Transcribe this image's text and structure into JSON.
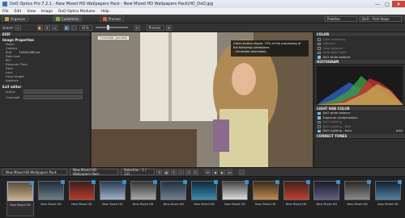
{
  "window": {
    "title": "DxO Optics Pro 7.2.1 - New Mixed HD Wallpapers Pack - New Mixed HD Wallpapers Pack\\HD_DxO.jpg",
    "minimize": "—",
    "maximize": "▢",
    "close": "✕"
  },
  "menu": [
    "File",
    "Edit",
    "View",
    "Image",
    "DxO Optics Modules",
    "Help"
  ],
  "toolbar": {
    "organize": "Organize",
    "customize": "Customize",
    "process": "Process",
    "palettes": "Palettes",
    "workspace": "DxO - First Steps"
  },
  "toolbar2": {
    "search": "Search",
    "zoom": "41%",
    "presets": "Presets"
  },
  "left_panel": {
    "title": "EXIF",
    "section": "Image Properties",
    "rows": [
      {
        "label": "Maker",
        "value": ""
      },
      {
        "label": "Camera",
        "value": ""
      },
      {
        "label": "Size",
        "value": "1920x1080 px"
      },
      {
        "label": "Date shot",
        "value": ""
      },
      {
        "label": "ISO",
        "value": ""
      },
      {
        "label": "Exposure Time",
        "value": ""
      },
      {
        "label": "Flash",
        "value": ""
      },
      {
        "label": "Lens",
        "value": ""
      },
      {
        "label": "Focal Length",
        "value": ""
      },
      {
        "label": "Aperture",
        "value": ""
      }
    ],
    "exif_editor": "Exif editor",
    "author_label": "Author",
    "copyright_label": "Copyright"
  },
  "viewer": {
    "tooltip": "Correction preview",
    "info_lines": [
      "Green button shows: 73% of the processing of",
      "the following corrections:",
      "- Chromatic aberration"
    ]
  },
  "right_panel": {
    "title": "COLOR",
    "options": [
      {
        "label": "Color rendering",
        "on": false
      },
      {
        "label": "Vibrancy",
        "on": false
      },
      {
        "label": "Color balance",
        "on": false
      },
      {
        "label": "Multi-point color",
        "on": false
      },
      {
        "label": "DxO white balance",
        "on": true
      }
    ],
    "histogram_title": "HISTOGRAM",
    "light_title": "LIGHT HSB COLOR",
    "light_options": [
      {
        "label": "DxO white balance",
        "on": true
      },
      {
        "label": "Exposure compensation",
        "on": true
      },
      {
        "label": "DxO Lighting",
        "on": false
      },
      {
        "label": "DxO Lighting - HSB",
        "on": false
      },
      {
        "label": "DxO Lighting - Auto",
        "on": true
      }
    ],
    "auto_label": "Auto",
    "footer_title": "CORRECT TONES"
  },
  "filmstrip_bar": {
    "folder": "New Mixed HD Wallpapers Pack",
    "project": "New Mixed HD Wallpapers Pack",
    "selection": "Selection : 1 / 131"
  },
  "filmstrip": [
    {
      "caption": "New Mixed HD"
    },
    {
      "caption": "New Mixed HD"
    },
    {
      "caption": "New Mixed HD"
    },
    {
      "caption": "New Mixed HD"
    },
    {
      "caption": "New Mixed HD"
    },
    {
      "caption": "New Mixed HD"
    },
    {
      "caption": "New Mixed HD"
    },
    {
      "caption": "New Mixed HD"
    },
    {
      "caption": "New Mixed HD"
    },
    {
      "caption": "New Mixed HD"
    },
    {
      "caption": "New Mixed HD"
    },
    {
      "caption": "New Mixed HD"
    },
    {
      "caption": "New Mixed HD"
    }
  ],
  "colors": {
    "accent": "#3a8fd0",
    "check_on": "#6ec3f0"
  }
}
